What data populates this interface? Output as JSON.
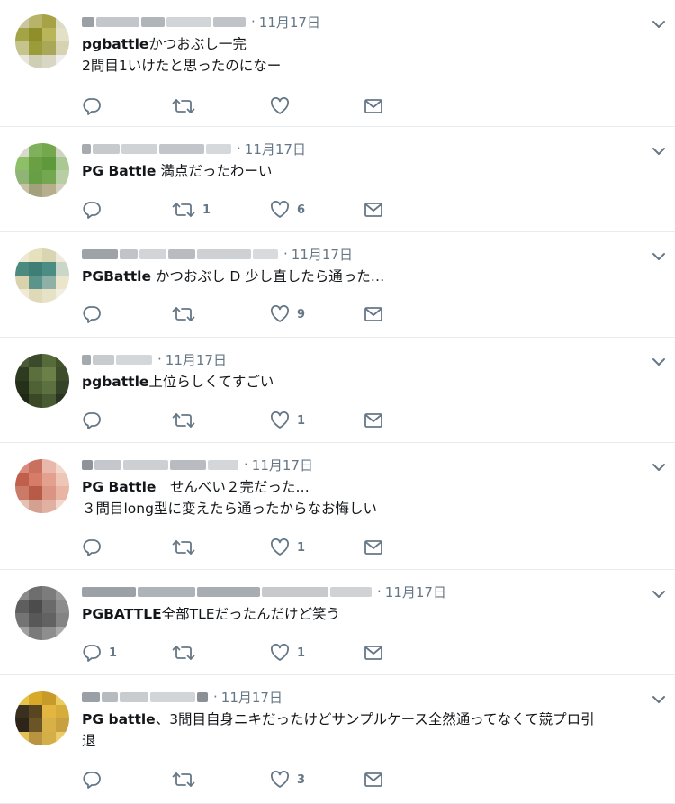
{
  "tweets": [
    {
      "date": "11月17日",
      "text_bold": "pgbattle",
      "text": "かつおぶし一完",
      "text_line2": "2問目1いけたと思ったのになー",
      "reply_count": "",
      "retweet_count": "",
      "like_count": "",
      "avatar_colors": [
        "#c9c7a0",
        "#b7b46a",
        "#a6a245",
        "#dcdcc6",
        "#a3a446",
        "#8e8e2a",
        "#b9b65a",
        "#e4e0c8",
        "#c6c38c",
        "#9c9b3a",
        "#a9a859",
        "#d6d2b2",
        "#e8e6da",
        "#cfcfb6",
        "#d9d6c4",
        "#eeeeee"
      ]
    },
    {
      "date": "11月17日",
      "text_bold": "PG Battle",
      "text": " 満点だったわーい",
      "text_line2": "",
      "reply_count": "",
      "retweet_count": "1",
      "like_count": "6",
      "avatar_colors": [
        "#d8d8cc",
        "#7fb05c",
        "#75a84e",
        "#cfd4c0",
        "#8cbf66",
        "#6aa043",
        "#5e9a3c",
        "#a9c893",
        "#90b476",
        "#67a044",
        "#74a850",
        "#b8cfa6",
        "#c7c2a6",
        "#a3a07c",
        "#b6ae8c",
        "#d4d0c0"
      ]
    },
    {
      "date": "11月17日",
      "text_bold": "PGBattle",
      "text": " かつおぶし D 少し直したら通った…",
      "text_line2": "",
      "reply_count": "",
      "retweet_count": "",
      "like_count": "9",
      "avatar_colors": [
        "#eee8d0",
        "#e6e0bc",
        "#d8d6b2",
        "#efeadb",
        "#4c8a80",
        "#3f7e75",
        "#4b8c83",
        "#c9d6c8",
        "#d9d2ac",
        "#5b948a",
        "#8fb0a6",
        "#ebe5cc",
        "#efe9d6",
        "#e0d9b8",
        "#e7e1c6",
        "#f1ede0"
      ]
    },
    {
      "date": "11月17日",
      "text_bold": "pgbattle",
      "text": "上位らしくてすごい",
      "text_line2": "",
      "reply_count": "",
      "retweet_count": "",
      "like_count": "1",
      "avatar_colors": [
        "#4a5a36",
        "#3b4a2a",
        "#566b3a",
        "#42522c",
        "#2f3b20",
        "#5a6e3e",
        "#6b8048",
        "#3d4d2a",
        "#263018",
        "#4f6236",
        "#5c7040",
        "#354428",
        "#1f2814",
        "#3a4826",
        "#485a32",
        "#2a3420"
      ]
    },
    {
      "date": "11月17日",
      "text_bold": "PG Battle",
      "text": "　せんべい２完だった…",
      "text_line2": "３問目long型に変えたら通ったからなお悔しい",
      "reply_count": "",
      "retweet_count": "",
      "like_count": "1",
      "avatar_colors": [
        "#d98a7c",
        "#c9705e",
        "#e8b8aa",
        "#f2d8cc",
        "#c0604c",
        "#d77c66",
        "#e4a08e",
        "#eec6b8",
        "#cc7a68",
        "#b85a48",
        "#dc9482",
        "#e8b4a4",
        "#e6c0b4",
        "#d4a090",
        "#e0b0a0",
        "#f0d8cc"
      ]
    },
    {
      "date": "11月17日",
      "text_bold": "PGBATTLE",
      "text": "全部TLEだったんだけど笑う",
      "text_line2": "",
      "reply_count": "1",
      "retweet_count": "",
      "like_count": "1",
      "avatar_colors": [
        "#8a8a8a",
        "#6e6e6e",
        "#7c7c7c",
        "#9a9a9a",
        "#5e5e5e",
        "#4c4c4c",
        "#6a6a6a",
        "#8c8c8c",
        "#747474",
        "#585858",
        "#626262",
        "#848484",
        "#a0a0a0",
        "#7a7a7a",
        "#8e8e8e",
        "#aaaaaa"
      ]
    },
    {
      "date": "11月17日",
      "text_bold": "PG battle",
      "text": "、3問目自身ニキだったけどサンプルケース全然通ってなくて競プロ引",
      "text_line2": "退",
      "reply_count": "",
      "retweet_count": "",
      "like_count": "3",
      "avatar_colors": [
        "#e6c24a",
        "#d8a828",
        "#c89a2a",
        "#e8cc60",
        "#3a3020",
        "#584620",
        "#e2b640",
        "#d6ac3a",
        "#2e2418",
        "#6a5428",
        "#d8b048",
        "#c8a040",
        "#e4c058",
        "#b89440",
        "#d4ae48",
        "#eccc68"
      ]
    }
  ]
}
